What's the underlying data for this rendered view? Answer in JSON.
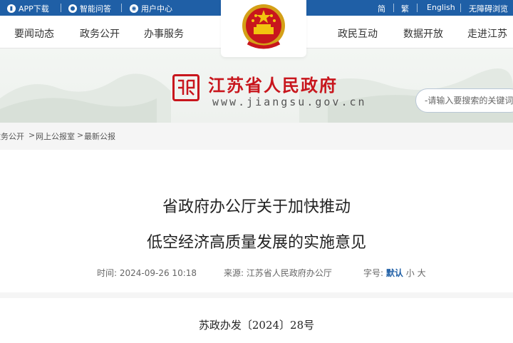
{
  "topbar": {
    "app_download": "APP下载",
    "smart_qa": "智能问答",
    "user_center": "用户中心",
    "simplified": "简",
    "traditional": "繁",
    "english": "English",
    "accessibility": "无障碍浏览"
  },
  "nav": {
    "left": [
      "要闻动态",
      "政务公开",
      "办事服务"
    ],
    "right": [
      "政民互动",
      "数据开放",
      "走进江苏"
    ]
  },
  "banner": {
    "title": "江苏省人民政府",
    "url": "www.jiangsu.gov.cn",
    "search_placeholder": "-请输入要搜索的关键词-"
  },
  "breadcrumb": [
    "政务公开",
    "网上公报室",
    "最新公报"
  ],
  "article": {
    "title_line1": "省政府办公厅关于加快推动",
    "title_line2": "低空经济高质量发展的实施意见",
    "time_label": "时间:",
    "time_value": "2024-09-26 10:18",
    "source_label": "来源:",
    "source_value": "江苏省人民政府办公厅",
    "fontsize_label": "字号:",
    "fontsize_default": "默认",
    "fontsize_small": "小",
    "fontsize_large": "大",
    "doc_number": "苏政办发〔2024〕28号"
  },
  "colors": {
    "topbar_bg": "#1f5fa6",
    "brand_red": "#c8161d",
    "link_blue": "#1f5fa6"
  }
}
